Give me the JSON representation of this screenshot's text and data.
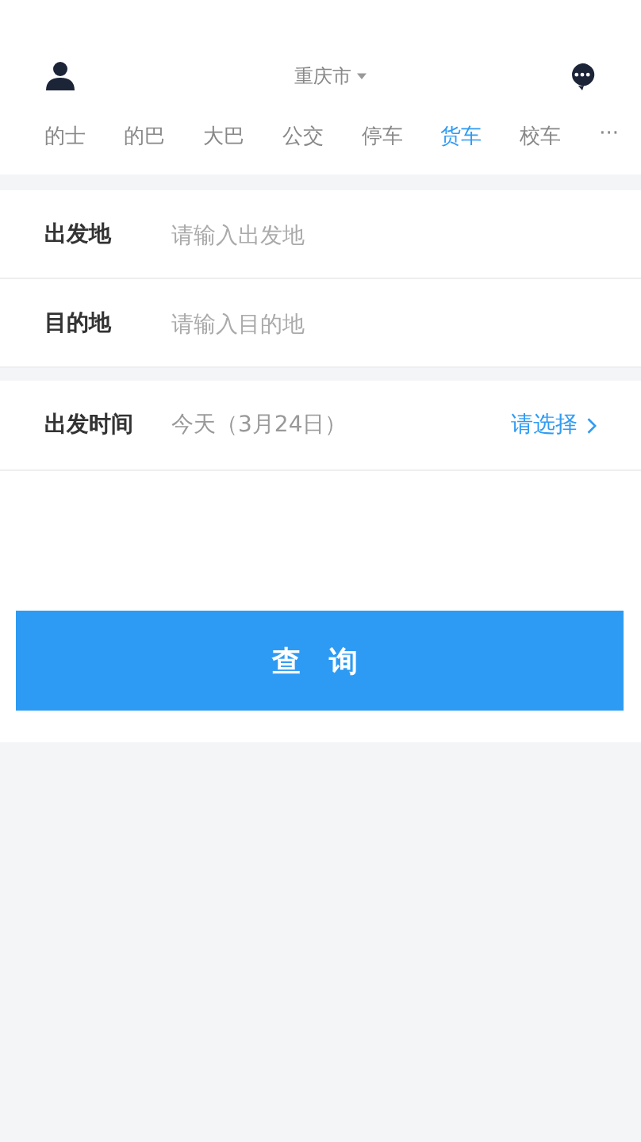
{
  "header": {
    "city": "重庆市"
  },
  "tabs": [
    {
      "label": "的士",
      "selected": false
    },
    {
      "label": "的巴",
      "selected": false
    },
    {
      "label": "大巴",
      "selected": false
    },
    {
      "label": "公交",
      "selected": false
    },
    {
      "label": "停车",
      "selected": false
    },
    {
      "label": "货车",
      "selected": true
    },
    {
      "label": "校车",
      "selected": false
    }
  ],
  "more": "···",
  "fields": [
    {
      "label": "出发地",
      "placeholder": "请输入出发地"
    },
    {
      "label": "目的地",
      "placeholder": "请输入目的地"
    }
  ],
  "time": {
    "label": "出发时间",
    "value": "今天（3月24日）",
    "action": "请选择"
  },
  "query_button": "查 询"
}
